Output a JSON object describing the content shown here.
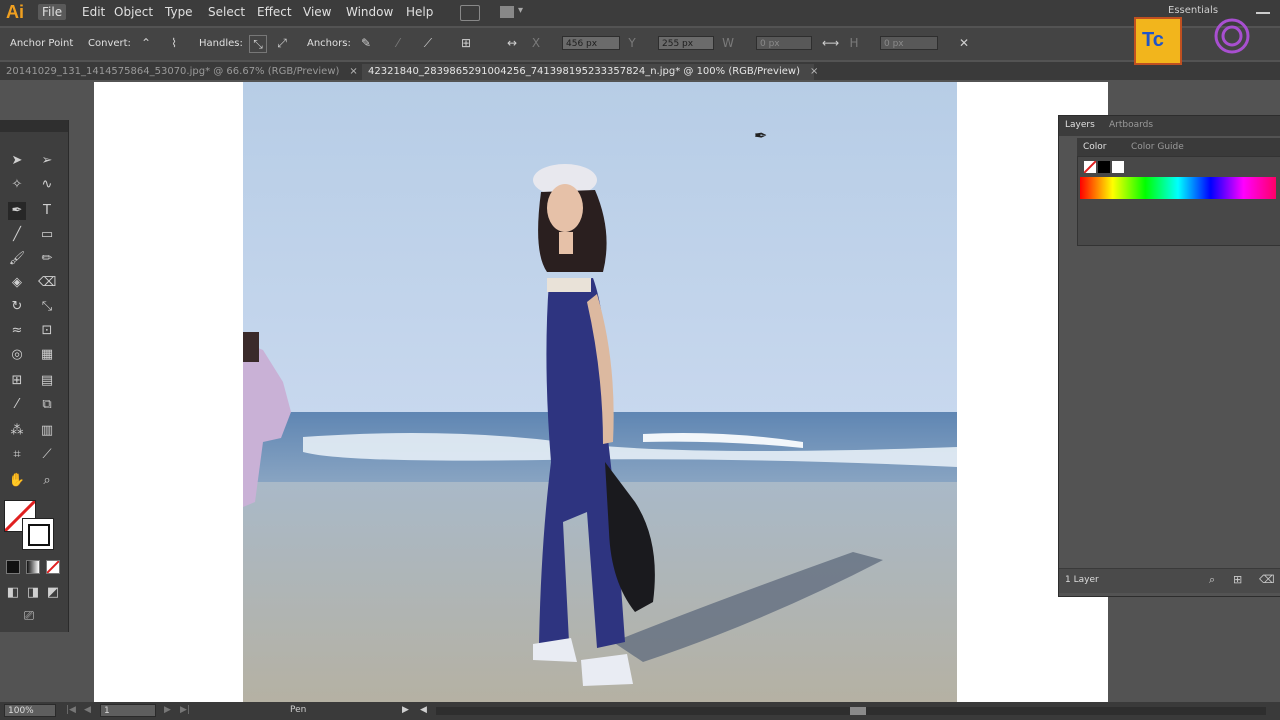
{
  "app": {
    "logo": "Ai",
    "workspace": "Essentials"
  },
  "menus": [
    "File",
    "Edit",
    "Object",
    "Type",
    "Select",
    "Effect",
    "View",
    "Window",
    "Help"
  ],
  "control_bar": {
    "anchor_point": "Anchor Point",
    "convert": "Convert:",
    "handles": "Handles:",
    "anchors": "Anchors:",
    "x_value": "456 px",
    "y_value": "255 px",
    "w_value": "0 px",
    "h_value": "0 px"
  },
  "tabs": [
    {
      "label": "20141029_131_1414575864_53070.jpg* @ 66.67% (RGB/Preview)",
      "close": "×"
    },
    {
      "label": "42321840_2839865291004256_741398195233357824_n.jpg* @ 100% (RGB/Preview)",
      "close": "×"
    }
  ],
  "panel": {
    "tab_layers": "Layers",
    "tab_artboards": "Artboards",
    "tab_color": "Color",
    "tab_color_guide": "Color Guide",
    "footer_layers": "1 Layer"
  },
  "status": {
    "zoom": "100%",
    "artboard": "1",
    "tool": "Pen"
  },
  "watermark": {
    "badge_text": "Tc"
  },
  "colors": {
    "accent": "#f0a020",
    "canvas": "#535353",
    "panel": "#3c3c3c"
  }
}
